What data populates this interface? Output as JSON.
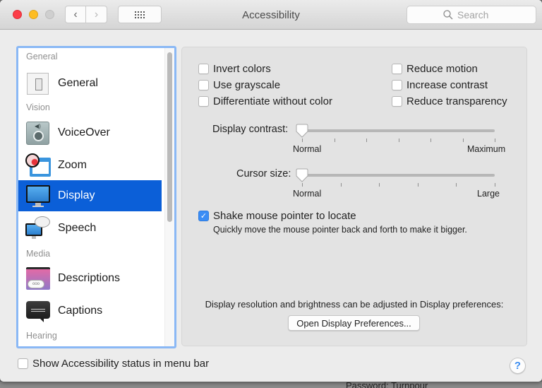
{
  "window": {
    "title": "Accessibility",
    "search_placeholder": "Search",
    "nav_back": "‹",
    "nav_forward": "›"
  },
  "sidebar": {
    "sections": [
      {
        "label": "General"
      },
      {
        "label": "Vision"
      },
      {
        "label": "Media"
      },
      {
        "label": "Hearing"
      }
    ],
    "items": [
      {
        "label": "General",
        "icon": "general-switch-icon",
        "selected": false
      },
      {
        "label": "VoiceOver",
        "icon": "voiceover-icon",
        "selected": false
      },
      {
        "label": "Zoom",
        "icon": "zoom-magnifier-icon",
        "selected": false
      },
      {
        "label": "Display",
        "icon": "display-monitor-icon",
        "selected": true
      },
      {
        "label": "Speech",
        "icon": "speech-bubble-icon",
        "selected": false
      },
      {
        "label": "Descriptions",
        "icon": "descriptions-icon",
        "selected": false
      },
      {
        "label": "Captions",
        "icon": "captions-icon",
        "selected": false
      }
    ]
  },
  "display": {
    "options_left": [
      {
        "label": "Invert colors",
        "checked": false
      },
      {
        "label": "Use grayscale",
        "checked": false
      },
      {
        "label": "Differentiate without color",
        "checked": false
      }
    ],
    "options_right": [
      {
        "label": "Reduce motion",
        "checked": false
      },
      {
        "label": "Increase contrast",
        "checked": false
      },
      {
        "label": "Reduce transparency",
        "checked": false
      }
    ],
    "contrast_slider": {
      "label": "Display contrast:",
      "min_label": "Normal",
      "max_label": "Maximum",
      "value_fraction": 0,
      "ticks": 7
    },
    "cursor_slider": {
      "label": "Cursor size:",
      "min_label": "Normal",
      "max_label": "Large",
      "value_fraction": 0,
      "ticks": 6
    },
    "shake": {
      "label": "Shake mouse pointer to locate",
      "checked": true,
      "description": "Quickly move the mouse pointer back and forth to make it bigger."
    },
    "info_text": "Display resolution and brightness can be adjusted in Display preferences:",
    "open_prefs_button": "Open Display Preferences..."
  },
  "footer": {
    "status_checkbox_label": "Show Accessibility status in menu bar",
    "status_checked": false,
    "help_label": "?"
  },
  "background_text": "Password: Turnpour",
  "colors": {
    "selection": "#0b5fd8",
    "focus_ring": "#8ab8f5",
    "checkbox_checked": "#3b8df5",
    "close": "#fc3d48",
    "minimize": "#fdbd23"
  }
}
